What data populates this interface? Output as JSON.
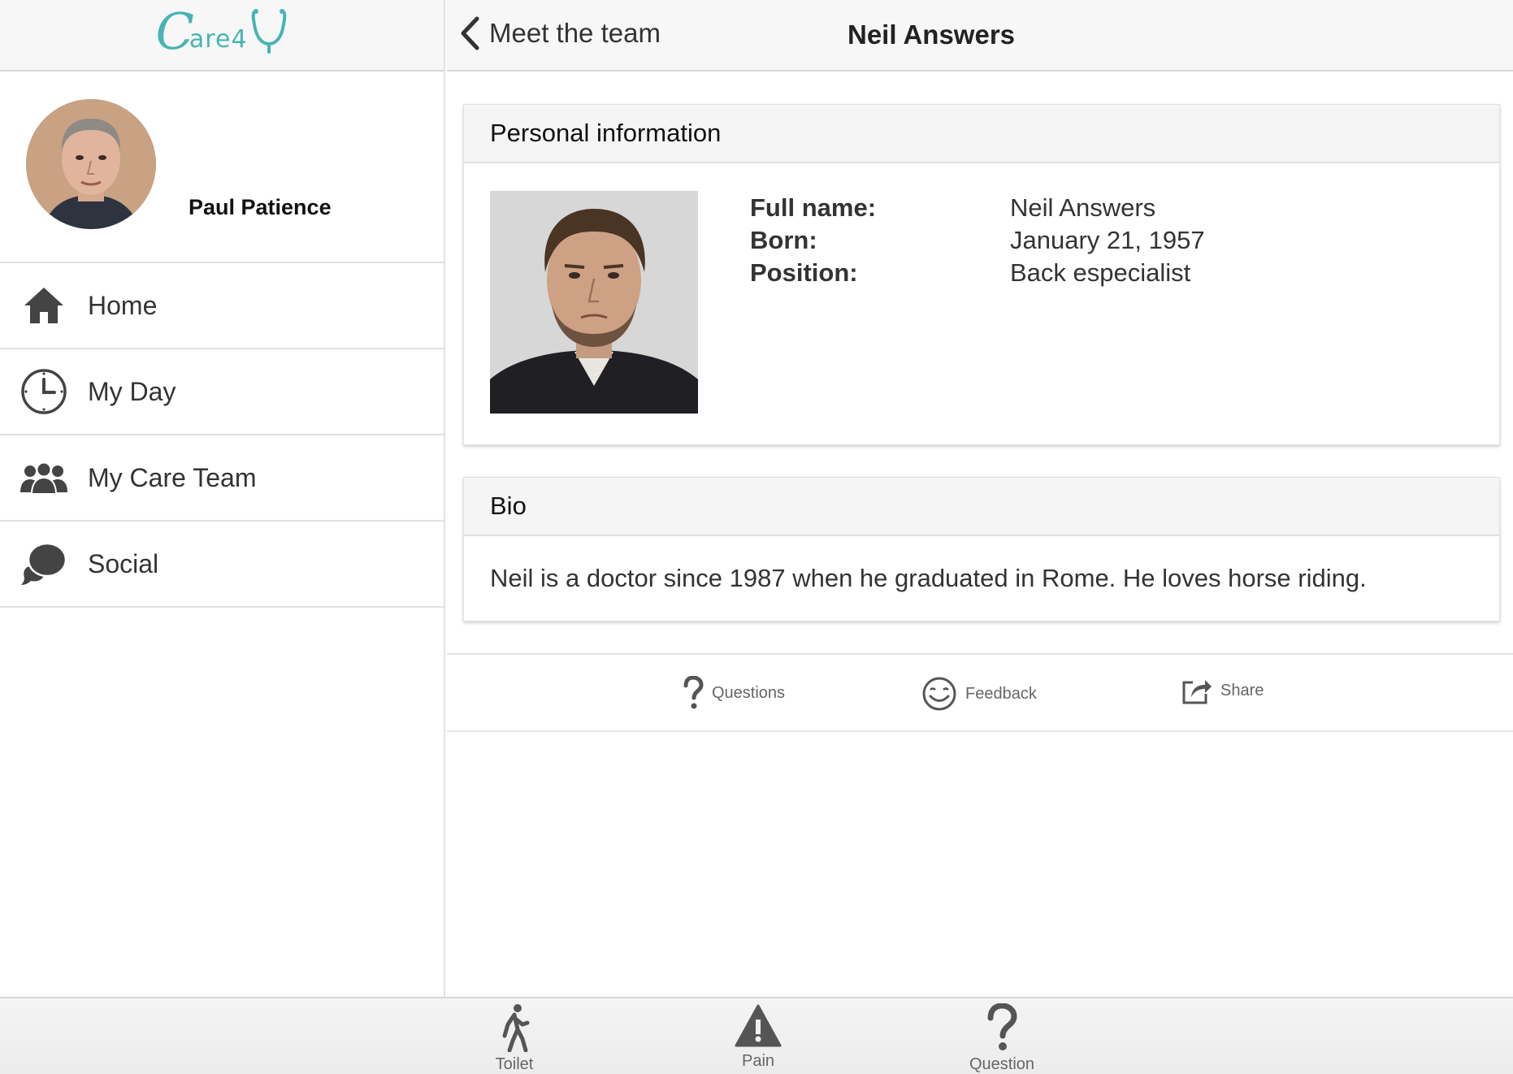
{
  "logo": {
    "c": "C",
    "rest": "are4"
  },
  "profile": {
    "name": "Paul Patience"
  },
  "nav": [
    {
      "label": "Home",
      "icon": "home-icon"
    },
    {
      "label": "My Day",
      "icon": "clock-icon"
    },
    {
      "label": "My Care Team",
      "icon": "team-icon"
    },
    {
      "label": "Social",
      "icon": "chat-icon"
    }
  ],
  "header": {
    "back_label": "Meet the team",
    "title": "Neil Answers"
  },
  "personal": {
    "heading": "Personal information",
    "rows": [
      {
        "label": "Full name:",
        "value": "Neil Answers"
      },
      {
        "label": "Born:",
        "value": "January 21, 1957"
      },
      {
        "label": "Position:",
        "value": "Back especialist"
      }
    ]
  },
  "bio": {
    "heading": "Bio",
    "text": "Neil is a doctor since 1987 when he graduated in Rome. He loves horse riding."
  },
  "actions": [
    {
      "label": "Questions",
      "icon": "question-icon"
    },
    {
      "label": "Feedback",
      "icon": "smiley-icon"
    },
    {
      "label": "Share",
      "icon": "share-icon"
    }
  ],
  "tabs": [
    {
      "label": "Toilet",
      "icon": "walking-person-icon"
    },
    {
      "label": "Pain",
      "icon": "warning-icon"
    },
    {
      "label": "Question",
      "icon": "question-icon"
    }
  ],
  "colors": {
    "brand": "#48b4b4",
    "icon": "#444444",
    "bar": "#f7f7f7"
  }
}
